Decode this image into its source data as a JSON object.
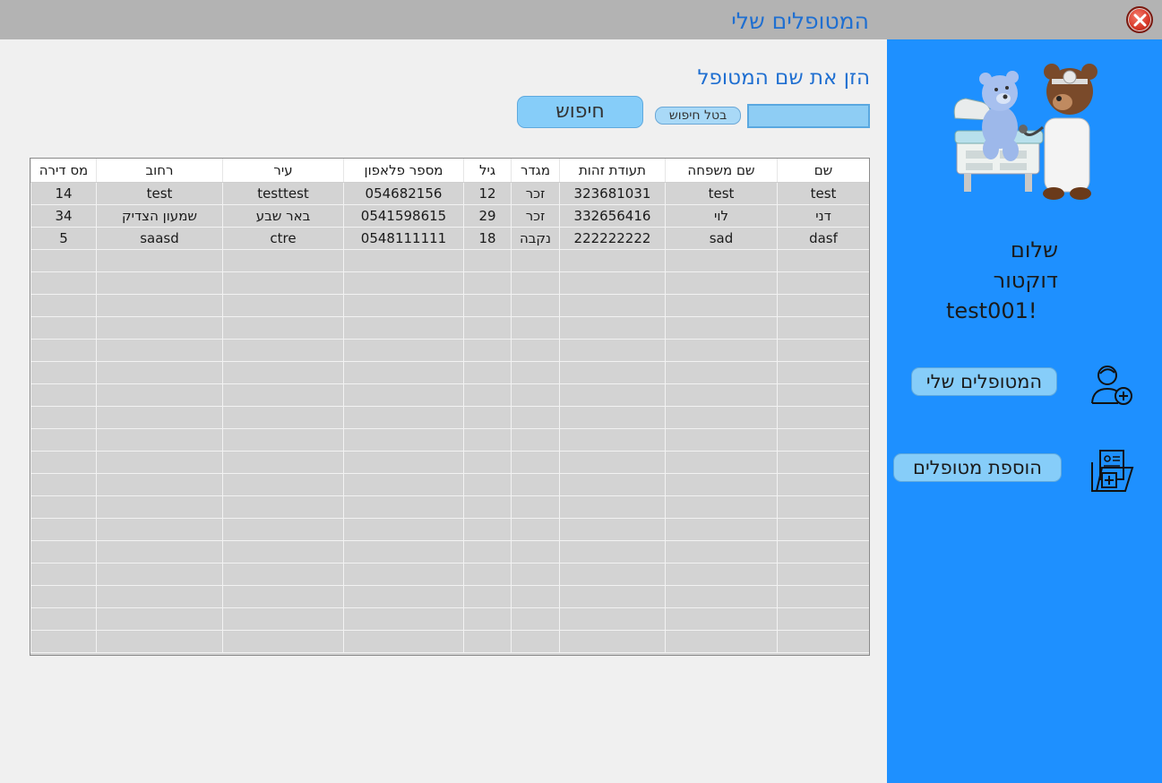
{
  "window": {
    "title": "המטופלים שלי"
  },
  "search": {
    "label": "הזן את שם המטופל",
    "value": "",
    "clear_label": "בטל חיפוש",
    "button_label": "חיפוש"
  },
  "sidebar": {
    "greeting_line1": "שלום דוקטור",
    "greeting_line2": "test001!",
    "my_patients_label": "המטופלים שלי",
    "add_patients_label": "הוספת מטופלים"
  },
  "table": {
    "columns": [
      "שם",
      "שם משפחה",
      "תעודת זהות",
      "מגדר",
      "גיל",
      "מספר פלאפון",
      "עיר",
      "רחוב",
      "מס דירה"
    ],
    "rows": [
      [
        "test",
        "test",
        "323681031",
        "זכר",
        "12",
        "054682156",
        "testtest",
        "test",
        "14"
      ],
      [
        "דני",
        "לוי",
        "332656416",
        "זכר",
        "29",
        "0541598615",
        "באר שבע",
        "שמעון הצדיק",
        "34"
      ],
      [
        "dasf",
        "sad",
        "222222222",
        "נקבה",
        "18",
        "0548111111",
        "ctre",
        "saasd",
        "5"
      ]
    ],
    "empty_row_count": 18
  },
  "colors": {
    "sidebar": "#1e90ff",
    "titlebar": "#b3b3b3",
    "button": "#86cdf9",
    "accent_text": "#1f6fd1"
  },
  "icons": {
    "close": "close-icon",
    "my_patients": "doctor-plus-icon",
    "add_patients": "medical-folder-icon",
    "mascot": "teddy-doctor-illustration"
  }
}
